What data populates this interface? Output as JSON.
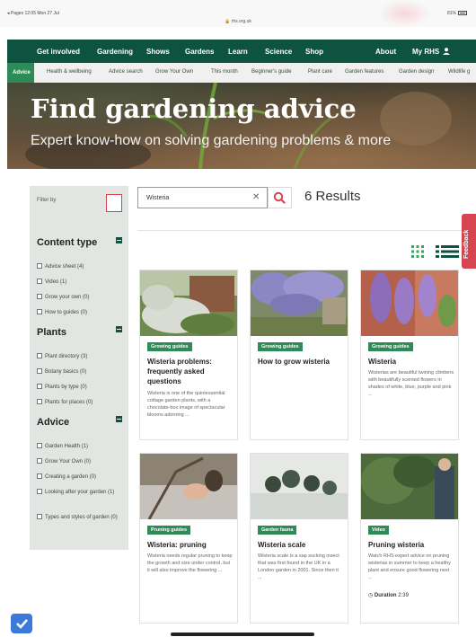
{
  "status_bar": {
    "left": "◂ Pages  12:05  Mon 27 Jul",
    "url": "rhs.org.uk",
    "battery": "81%"
  },
  "main_nav": [
    "Get involved",
    "Gardening",
    "Shows",
    "Gardens",
    "Learn",
    "Science",
    "Shop",
    "About",
    "My RHS"
  ],
  "sub_nav": [
    "Advice",
    "Health & wellbeing",
    "Advice search",
    "Grow Your Own",
    "This month",
    "Beginner's guide",
    "Plant care",
    "Garden features",
    "Garden design",
    "Wildlife g"
  ],
  "hero": {
    "title": "Find gardening advice",
    "subtitle": "Expert know-how on solving gardening problems & more"
  },
  "filter": {
    "label": "Filter by",
    "sections": [
      {
        "title": "Content type",
        "options": [
          "Advice sheet (4)",
          "Video (1)",
          "Grow your own (0)",
          "How to guides (0)"
        ]
      },
      {
        "title": "Plants",
        "options": [
          "Plant directory (3)",
          "Botany basics (0)",
          "Plants by type (0)",
          "Plants for places (0)"
        ]
      },
      {
        "title": "Advice",
        "options": [
          "Garden Health (1)",
          "Grow Your Own (0)",
          "Creating a garden (0)",
          "Looking after your garden (1)",
          "Types and styles of garden (0)"
        ]
      }
    ]
  },
  "search": {
    "value": "Wisteria",
    "results": "6 Results"
  },
  "feedback": "Feedback",
  "cards": [
    {
      "tag": "Growing guides",
      "title": "Wisteria problems: frequently asked questions",
      "desc": "Wisteria is one of the quintessential cottage garden plants, with a chocolate-box image of spectacular blooms adorning ..."
    },
    {
      "tag": "Growing guides",
      "title": "How to grow wisteria",
      "desc": ""
    },
    {
      "tag": "Growing guides",
      "title": "Wisteria",
      "desc": "Wisterias are beautiful twining climbers with beautifully scented flowers in shades of white, blue, purple and pink ..."
    },
    {
      "tag": "Pruning guides",
      "title": "Wisteria: pruning",
      "desc": "Wisteria needs regular pruning to keep the growth and size under control, but it will also improve the flowering ..."
    },
    {
      "tag": "Garden fauna",
      "title": "Wisteria scale",
      "desc": "Wisteria scale is a sap sucking insect that was first found in the UK in a London garden in 2001. Since then it ..."
    },
    {
      "tag": "Video",
      "title": "Pruning wisteria",
      "desc": "Watch RHS expert advice on pruning wisterias in summer to keep a healthy plant and ensure good flowering next ...",
      "duration_label": "Duration",
      "duration": "2:39"
    }
  ],
  "colors": {
    "brand_green": "#0d5340",
    "tag_green": "#2e8b57",
    "accent_red": "#d64550"
  }
}
